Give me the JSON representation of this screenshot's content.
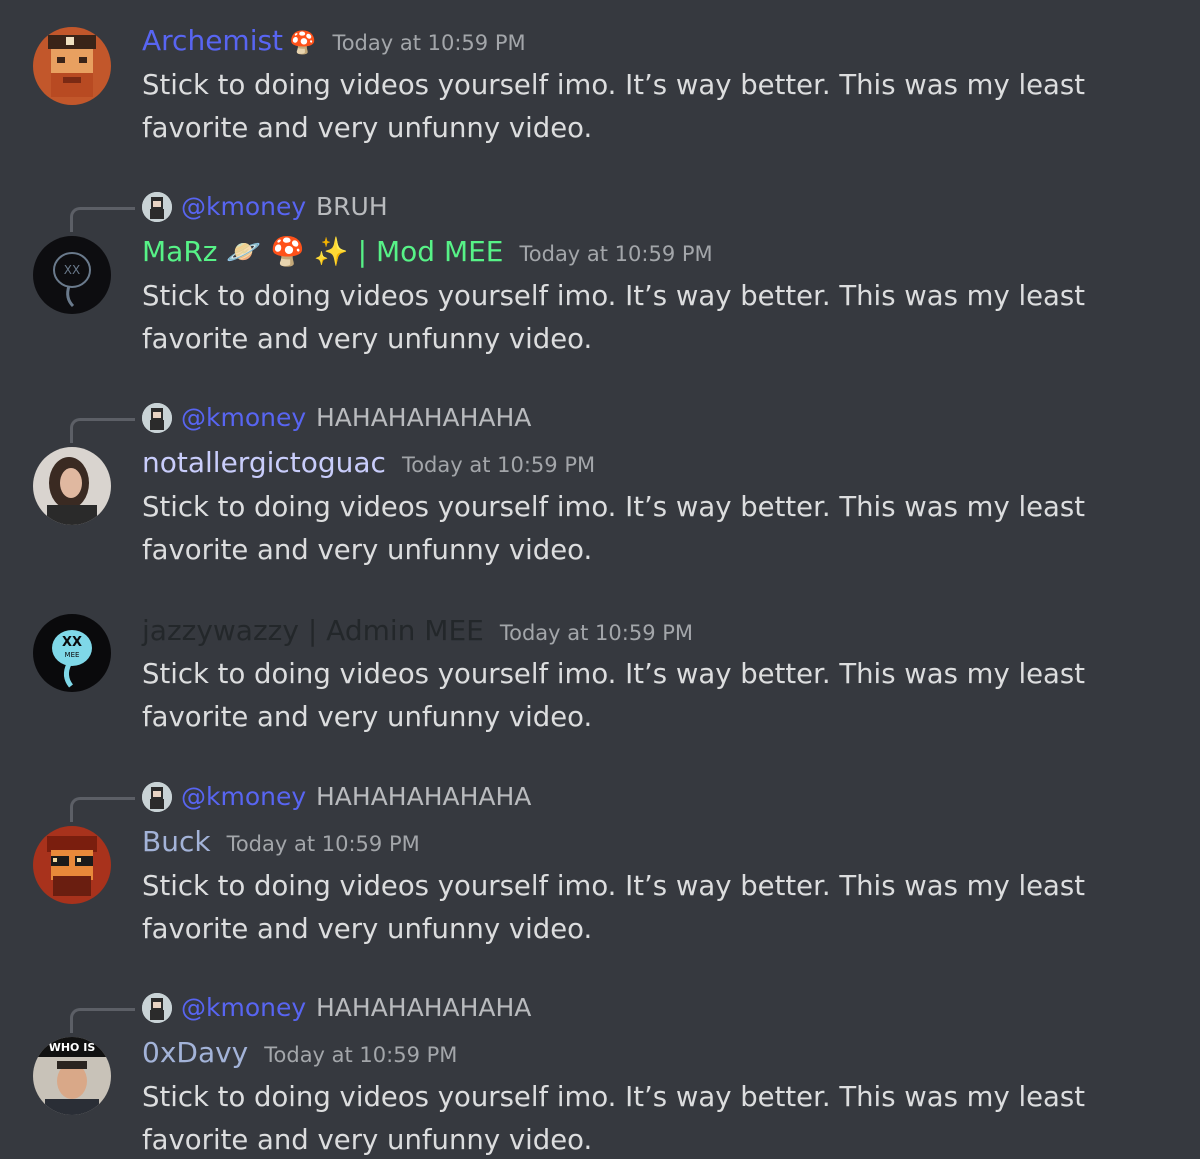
{
  "colors": {
    "background": "#36393f",
    "mention": "#5865f2",
    "timestamp": "#a3a6aa",
    "text": "#dcddde"
  },
  "messages": [
    {
      "username": "Archemist",
      "name_color": "#5865f2",
      "badge_emoji": "🍄",
      "timestamp": "Today at 10:59 PM",
      "text": "Stick to doing videos yourself imo. It’s way better. This was my least favorite and very unfunny video.",
      "avatar_icon": "pixel-pirate-avatar"
    },
    {
      "reply": {
        "mention": "@kmoney",
        "content": "BRUH"
      },
      "username": "MaRz 🪐 🍄 ✨ | Mod MEE",
      "name_color": "#57f287",
      "timestamp": "Today at 10:59 PM",
      "text": "Stick to doing videos yourself imo. It’s way better. This was my least favorite and very unfunny video.",
      "avatar_icon": "dark-skull-avatar"
    },
    {
      "reply": {
        "mention": "@kmoney",
        "content": "HAHAHAHAHAHA"
      },
      "username": "notallergictoguac",
      "name_color": "#c9cdfb",
      "timestamp": "Today at 10:59 PM",
      "text": "Stick to doing videos yourself imo. It’s way better. This was my least favorite and very unfunny video.",
      "avatar_icon": "photo-portrait-avatar"
    },
    {
      "username": "jazzywazzy | Admin MEE",
      "name_color": "#23272a",
      "timestamp": "Today at 10:59 PM",
      "text": "Stick to doing videos yourself imo. It’s way better. This was my least favorite and very unfunny video.",
      "avatar_icon": "cyan-skull-avatar",
      "avatar_label": "MEE"
    },
    {
      "reply": {
        "mention": "@kmoney",
        "content": "HAHAHAHAHAHA"
      },
      "username": "Buck",
      "name_color": "#a3b3d8",
      "timestamp": "Today at 10:59 PM",
      "text": "Stick to doing videos yourself imo. It’s way better. This was my least favorite and very unfunny video.",
      "avatar_icon": "pixel-sunglasses-avatar"
    },
    {
      "reply": {
        "mention": "@kmoney",
        "content": "HAHAHAHAHAHA"
      },
      "username": "0xDavy",
      "name_color": "#a3b3d8",
      "timestamp": "Today at 10:59 PM",
      "text": "Stick to doing videos yourself imo. It’s way better. This was my least favorite and very unfunny video.",
      "avatar_icon": "who-is-meme-avatar",
      "avatar_label": "WHO IS"
    }
  ]
}
